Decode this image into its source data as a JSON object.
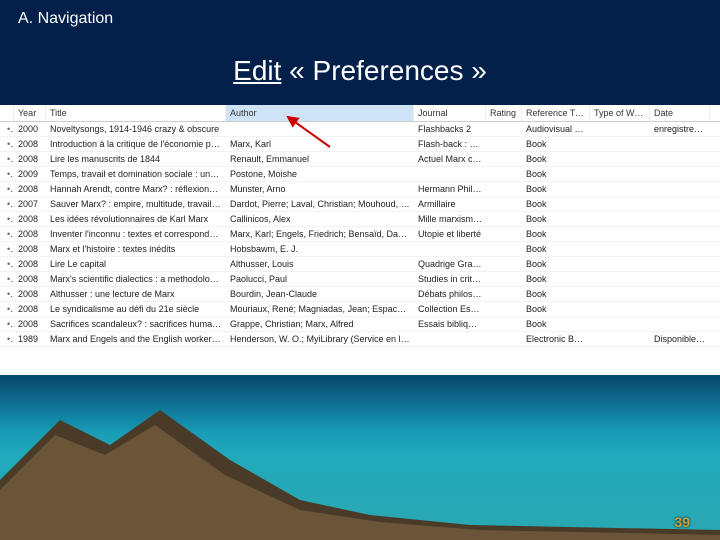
{
  "section_label": "A.  Navigation",
  "instruction": {
    "edit": "Edit",
    "prefs": " «  Preferences  »"
  },
  "page_number": "39",
  "columns": {
    "year": "Year",
    "title": "Title",
    "author": "Author",
    "journal": "Journal",
    "rating": "Rating",
    "reftype": "Reference Type",
    "typeofwork": "Type of Work",
    "date": "Date"
  },
  "rows": [
    {
      "year": "2000",
      "title": "Noveltysongs, 1914-1946 crazy & obscure",
      "author": "",
      "journal": "Flashbacks 2",
      "reftype": "Audiovisual Ma...",
      "date": "enregistremen..."
    },
    {
      "year": "2008",
      "title": "Introduction à la critique de l'économie politiq...",
      "author": "Marx, Karl",
      "journal": "Flash-back : essai",
      "reftype": "Book",
      "date": ""
    },
    {
      "year": "2008",
      "title": "Lire les manuscrits de 1844",
      "author": "Renault, Emmanuel",
      "journal": "Actuel Marx co...",
      "reftype": "Book",
      "date": ""
    },
    {
      "year": "2009",
      "title": "Temps, travail et domination sociale : une réint...",
      "author": "Postone, Moishe",
      "journal": "",
      "reftype": "Book",
      "date": ""
    },
    {
      "year": "2008",
      "title": "Hannah Arendt, contre Marx? : réflexions sur u...",
      "author": "Munster, Arno",
      "journal": "Hermann Philo...",
      "reftype": "Book",
      "date": ""
    },
    {
      "year": "2007",
      "title": "Sauver Marx? : empire, multitude, travail im...",
      "author": "Dardot, Pierre; Laval, Christian; Mouhoud, E. M.",
      "journal": "Armillaire",
      "reftype": "Book",
      "date": ""
    },
    {
      "year": "2008",
      "title": "Les idées révolutionnaires de Karl Marx",
      "author": "Callinicos, Alex",
      "journal": "Mille marxismes",
      "reftype": "Book",
      "date": ""
    },
    {
      "year": "2008",
      "title": "Inventer l'inconnu : textes et correspondance ...",
      "author": "Marx, Karl; Engels, Friedrich; Bensaïd, Daniel",
      "journal": "Utopie et liberté",
      "reftype": "Book",
      "date": ""
    },
    {
      "year": "2008",
      "title": "Marx et l'histoire : textes inédits",
      "author": "Hobsbawm, E. J.",
      "journal": "",
      "reftype": "Book",
      "date": ""
    },
    {
      "year": "2008",
      "title": "Lire Le capital",
      "author": "Althusser, Louis",
      "journal": "Quadrige Gran...",
      "reftype": "Book",
      "date": ""
    },
    {
      "year": "2008",
      "title": "Marx's scientific dialectics : a methodological t...",
      "author": "Paolucci, Paul",
      "journal": "Studies in critic...",
      "reftype": "Book",
      "date": ""
    },
    {
      "year": "2008",
      "title": "Althusser : une lecture de Marx",
      "author": "Bourdin, Jean-Claude",
      "journal": "Débats philoso...",
      "reftype": "Book",
      "date": ""
    },
    {
      "year": "2008",
      "title": "Le syndicalisme au défi du 21e siècle",
      "author": "Mouriaux, René; Magniadas, Jean; Espaces Marx (Associatio...",
      "journal": "Collection Espa...",
      "reftype": "Book",
      "date": ""
    },
    {
      "year": "2008",
      "title": "Sacrifices scandaleux? : sacrifices humains, mor...",
      "author": "Grappe, Christian; Marx, Alfred",
      "journal": "Essais bibliques",
      "reftype": "Book",
      "date": ""
    },
    {
      "year": "1989",
      "title": "Marx and Engels and the English workers and o...",
      "author": "Henderson, W. O.; MyiLibrary (Service en ligne)",
      "journal": "",
      "reftype": "Electronic Book",
      "date": "Disponible en f..."
    }
  ]
}
